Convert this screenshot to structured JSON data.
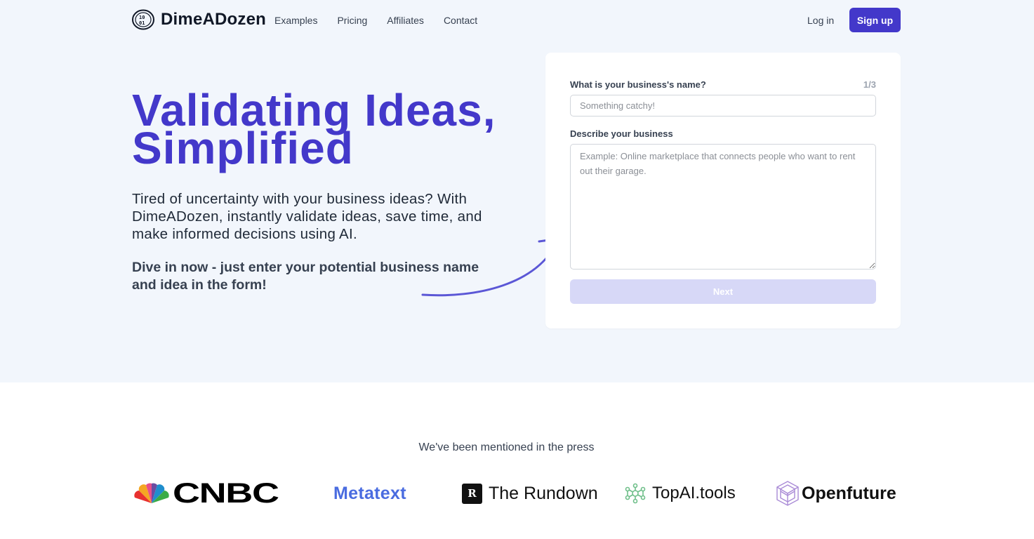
{
  "nav": {
    "brand": "DimeADozen",
    "links": [
      "Examples",
      "Pricing",
      "Affiliates",
      "Contact"
    ],
    "login": "Log in",
    "signup": "Sign up"
  },
  "hero": {
    "headline_line1": "Validating Ideas,",
    "headline_line2": "Simplified",
    "subtext": "Tired of uncertainty with your business ideas? With DimeADozen, instantly validate ideas, save time, and make informed decisions using AI.",
    "cta": "Dive in now - just enter your potential business name and idea in the form!"
  },
  "form": {
    "question1": "What is your business's name?",
    "step": "1/3",
    "name_placeholder": "Something catchy!",
    "name_value": "",
    "question2": "Describe your business",
    "description_placeholder": "Example: Online marketplace that connects people who want to rent out their garage.",
    "description_value": "",
    "next_label": "Next"
  },
  "press": {
    "title": "We've been mentioned in the press",
    "logos": [
      "CNBC",
      "Metatext",
      "The Rundown",
      "TopAI.tools",
      "Openfuture"
    ]
  },
  "colors": {
    "accent": "#4338ca",
    "hero_bg": "#f2f6fc",
    "next_disabled": "#d7d8f7"
  }
}
